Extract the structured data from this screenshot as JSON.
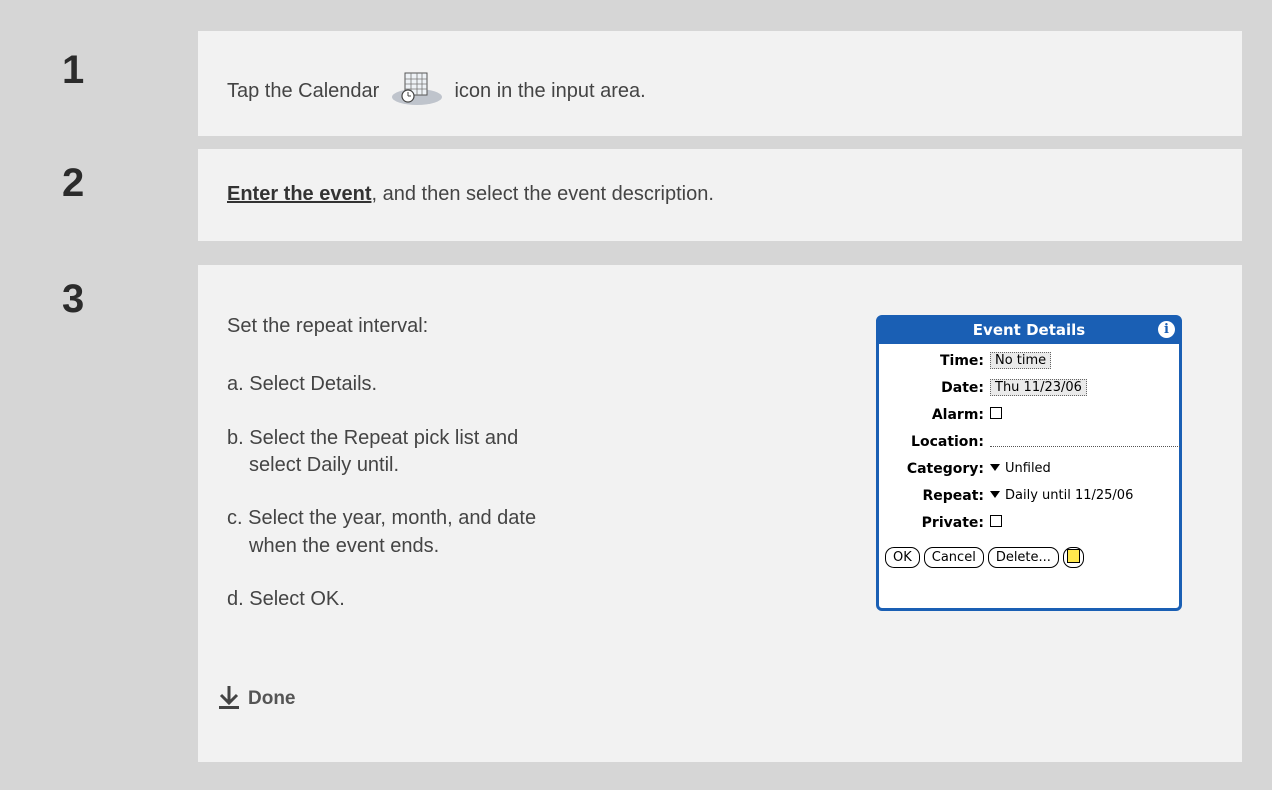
{
  "steps": [
    {
      "number": "1",
      "text_before": "Tap the Calendar",
      "icon": "calendar-icon",
      "text_after": "icon in the input area."
    },
    {
      "number": "2",
      "link_text": "Enter the event",
      "text_after": ", and then select the event description."
    },
    {
      "number": "3",
      "intro": "Set the repeat interval:",
      "items": [
        "a.  Select Details.",
        "b.  Select the Repeat pick list and",
        "select Daily until.",
        "c.  Select the year, month, and date",
        "when the event ends.",
        "d.  Select OK."
      ],
      "done_label": "Done"
    }
  ],
  "dialog": {
    "title": "Event Details",
    "info_icon": "i",
    "fields": {
      "time_label": "Time:",
      "time_value": "No time",
      "date_label": "Date:",
      "date_value": "Thu 11/23/06",
      "alarm_label": "Alarm:",
      "location_label": "Location:",
      "category_label": "Category:",
      "category_value": "Unfiled",
      "repeat_label": "Repeat:",
      "repeat_value": "Daily until 11/25/06",
      "private_label": "Private:"
    },
    "buttons": {
      "ok": "OK",
      "cancel": "Cancel",
      "delete": "Delete..."
    }
  },
  "colors": {
    "accent": "#1a5fb4",
    "panel": "#f2f2f2",
    "background": "#d6d6d6"
  }
}
